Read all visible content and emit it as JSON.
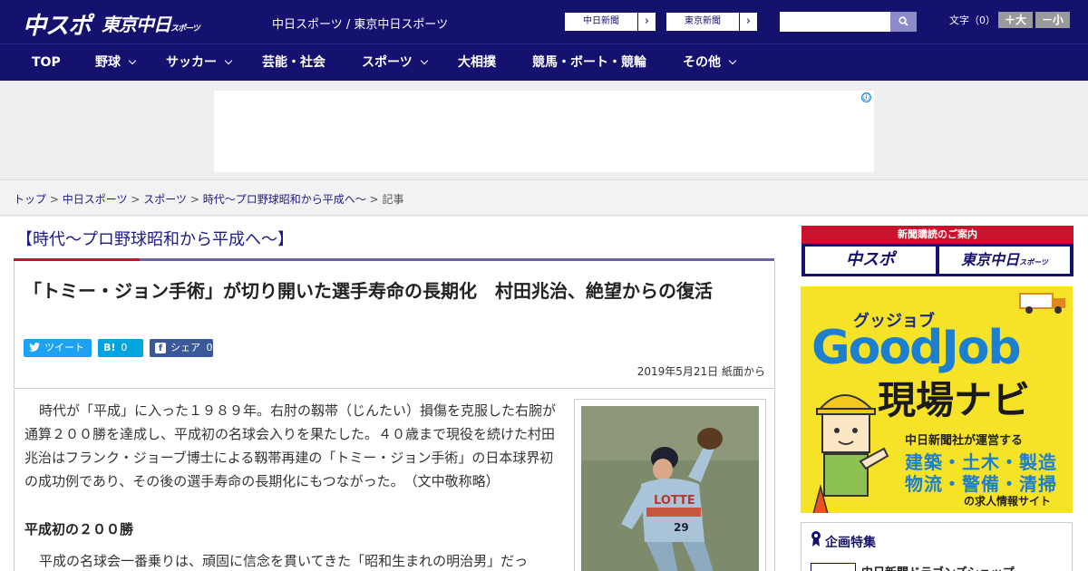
{
  "header": {
    "logo_main": "中スポ",
    "logo_sub": "東京中日",
    "logo_sub_small": "スポーツ",
    "site_links": "中日スポーツ / 東京中日スポーツ",
    "ext_links": [
      {
        "label": "中日新聞",
        "arrow": "›"
      },
      {
        "label": "東京新聞",
        "arrow": "›"
      }
    ],
    "search": {
      "value": "",
      "placeholder": ""
    },
    "fontsize_label": "文字（0）",
    "fontsize_bigger": "＋大",
    "fontsize_smaller": "－小"
  },
  "nav": [
    {
      "label": "TOP",
      "dropdown": false
    },
    {
      "label": "野球",
      "dropdown": true
    },
    {
      "label": "サッカー",
      "dropdown": true
    },
    {
      "label": "芸能・社会",
      "dropdown": false
    },
    {
      "label": "スポーツ",
      "dropdown": true
    },
    {
      "label": "大相撲",
      "dropdown": false
    },
    {
      "label": "競馬・ボート・競輪",
      "dropdown": false
    },
    {
      "label": "その他",
      "dropdown": true
    }
  ],
  "ad": {
    "info_icon": "ⓘ"
  },
  "breadcrumb": {
    "items": [
      "トップ",
      "中日スポーツ",
      "スポーツ",
      "時代～プロ野球昭和から平成へ～"
    ],
    "separator": ">",
    "current": "記事"
  },
  "article": {
    "series_title": "【時代～プロ野球昭和から平成へ～】",
    "headline": "「トミー・ジョン手術」が切り開いた選手寿命の長期化　村田兆治、絶望からの復活",
    "share": {
      "tweet": "ツイート",
      "hatena_icon": "B!",
      "hatena_count": "0",
      "facebook_icon": "f",
      "facebook_label": "シェア",
      "facebook_count": "0"
    },
    "date": "2019年5月21日 紙面から",
    "paragraph1": "時代が「平成」に入った１９８９年。右肘の靱帯（じんたい）損傷を克服した右腕が通算２００勝を達成し、平成初の名球会入りを果たした。４０歳まで現役を続けた村田兆治はフランク・ジョーブ博士による靱帯再建の「トミー・ジョン手術」の日本球界初の成功例であり、その後の選手寿命の長期化にもつながった。　（文中敬称略）",
    "subhead": "平成初の２００勝",
    "paragraph2": "平成の名球会一番乗りは、頑固に信念を貫いてきた「昭和生まれの明治男」だっ",
    "photo_jersey_text": "LOTTE",
    "photo_number": "29"
  },
  "sidebar": {
    "news_banner_title": "新聞購読のご案内",
    "news_buttons": [
      "中スポ",
      "東京中日"
    ],
    "news_button_small": "スポーツ",
    "goodjob": {
      "sub": "グッジョブ",
      "title": "GoodJob",
      "nav": "現場ナビ",
      "line1": "中日新聞社が運営する",
      "line2": "建築・土木・製造",
      "line3": "物流・警備・清掃",
      "line4": "の求人情報サイト"
    },
    "special_title": "企画特集",
    "special_item": "中日新聞ドラゴンズショップ"
  },
  "colors": {
    "brand_navy": "#15116e",
    "accent_red": "#c8122e",
    "link_blue": "#1c1a86",
    "twitter": "#1da1f2",
    "hatena": "#00a4de",
    "facebook": "#3b5998",
    "goodjob_yellow": "#f6e226"
  }
}
